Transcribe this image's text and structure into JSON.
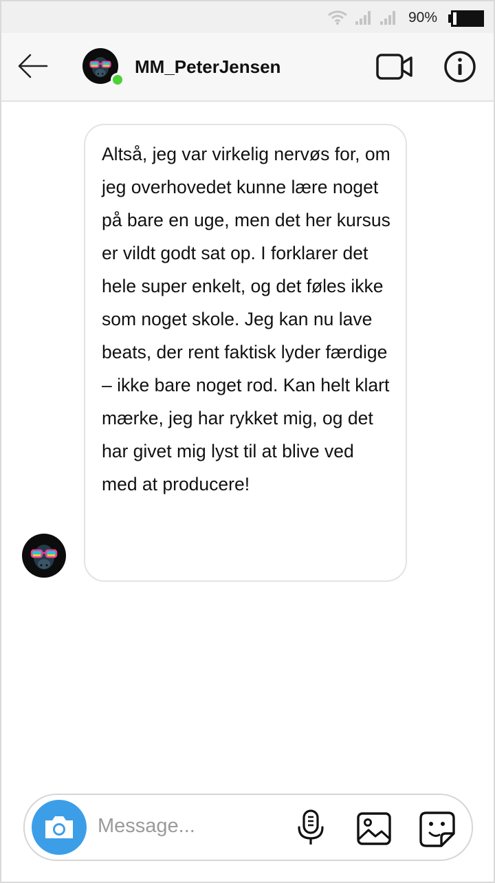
{
  "status_bar": {
    "battery_percent": "90%",
    "wifi_icon": "wifi-icon",
    "signal_icon": "signal-icon",
    "battery_icon": "battery-icon"
  },
  "header": {
    "username": "MM_PeterJensen",
    "online": true,
    "back_icon": "arrow-left-icon",
    "video_icon": "video-camera-icon",
    "info_icon": "info-icon"
  },
  "conversation": {
    "messages": [
      {
        "text": "Altså, jeg var virkelig nervøs for, om jeg overhovedet kunne lære noget på bare en uge, men det her kursus er vildt godt sat op. I forklarer det hele super enkelt, og det føles ikke som noget skole. Jeg kan nu lave beats, der rent faktisk lyder færdige – ikke bare noget rod. Kan helt klart mærke, jeg har rykket mig, og det har givet mig lyst til at blive ved med at producere!"
      }
    ]
  },
  "composer": {
    "placeholder": "Message...",
    "value": "",
    "camera_icon": "camera-icon",
    "mic_icon": "microphone-icon",
    "gallery_icon": "image-icon",
    "sticker_icon": "sticker-icon"
  },
  "colors": {
    "accent": "#3d9ee8",
    "online": "#4cd137",
    "header_bg": "#f7f7f7",
    "status_bg": "#f0f0f0"
  }
}
